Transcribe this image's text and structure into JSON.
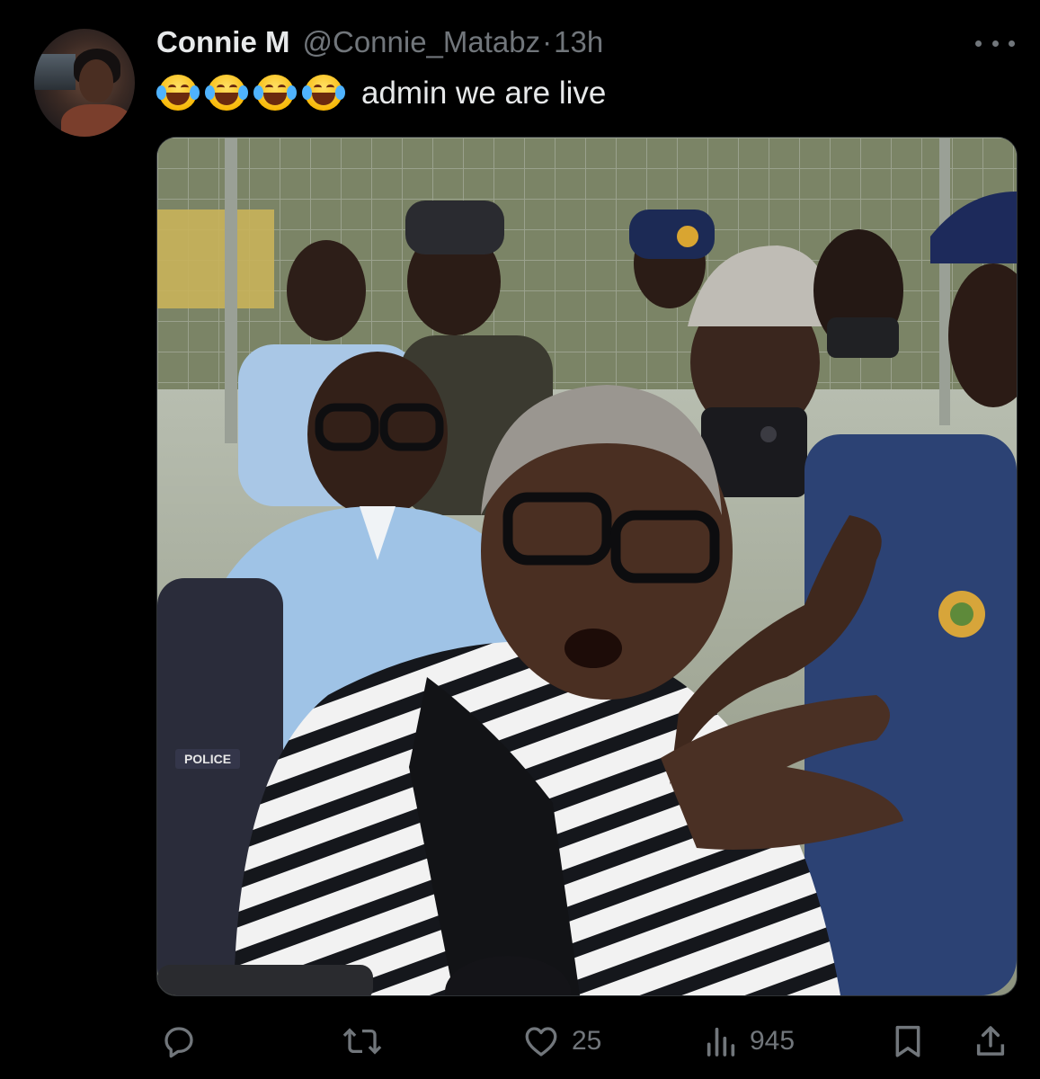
{
  "tweet": {
    "author_name": "Connie M",
    "author_handle": "@Connie_Matabz",
    "separator": "·",
    "timestamp": "13h",
    "emojis": "😂😂😂😂",
    "text": "admin we are live"
  },
  "media": {
    "alt": "Photo of a woman in a striped cardigan and glasses speaking and gesturing in a crowd with police officers behind a fence",
    "badge_text": "POLICE"
  },
  "actions": {
    "reply_count": "",
    "repost_count": "",
    "like_count": "25",
    "views_count": "945"
  },
  "colors": {
    "background": "#000000",
    "primary_text": "#e7e9ea",
    "secondary_text": "#71767b"
  },
  "icons": [
    "more-icon",
    "reply-icon",
    "repost-icon",
    "like-icon",
    "views-icon",
    "bookmark-icon",
    "share-icon"
  ]
}
